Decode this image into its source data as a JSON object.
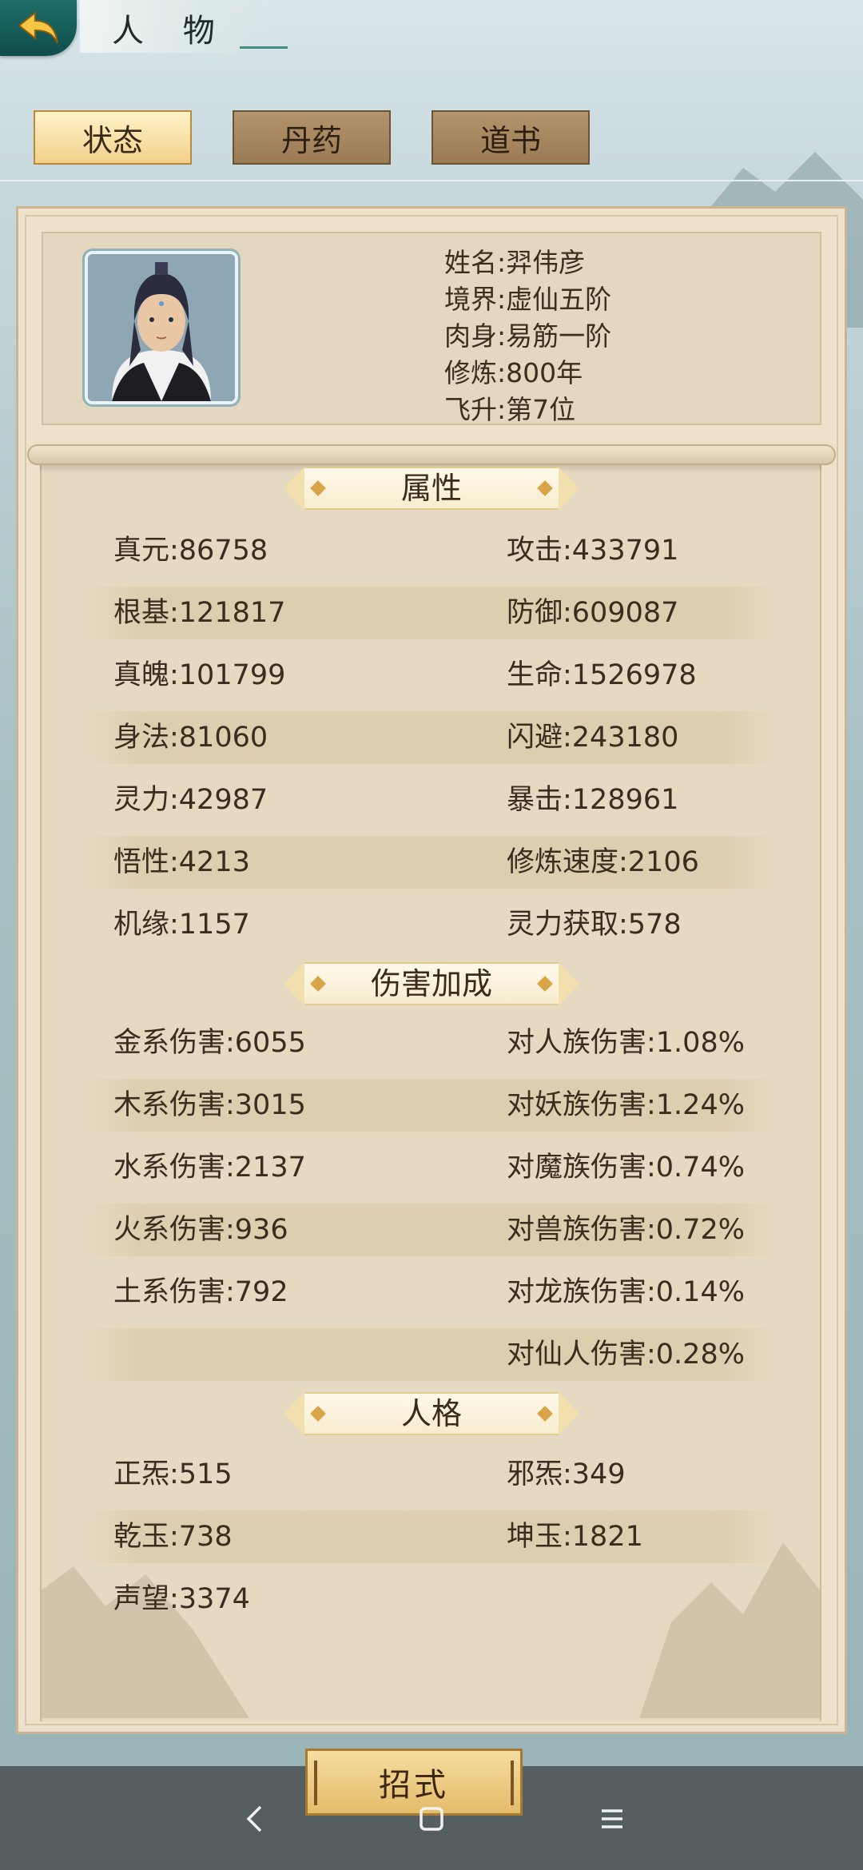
{
  "header": {
    "title": "人 物"
  },
  "tabs": [
    {
      "label": "状态",
      "active": true
    },
    {
      "label": "丹药",
      "active": false
    },
    {
      "label": "道书",
      "active": false
    }
  ],
  "profile": {
    "name": "姓名:羿伟彦",
    "realm": "境界:虚仙五阶",
    "body": "肉身:易筋一阶",
    "cultivation": "修炼:800年",
    "ascension": "飞升:第7位"
  },
  "sections": {
    "attributes": "属性",
    "damage": "伤害加成",
    "personality": "人格"
  },
  "attributes": [
    [
      "真元:86758",
      "攻击:433791"
    ],
    [
      "根基:121817",
      "防御:609087"
    ],
    [
      "真魄:101799",
      "生命:1526978"
    ],
    [
      "身法:81060",
      "闪避:243180"
    ],
    [
      "灵力:42987",
      "暴击:128961"
    ],
    [
      "悟性:4213",
      "修炼速度:2106"
    ],
    [
      "机缘:1157",
      "灵力获取:578"
    ]
  ],
  "damage": [
    [
      "金系伤害:6055",
      "对人族伤害:1.08%"
    ],
    [
      "木系伤害:3015",
      "对妖族伤害:1.24%"
    ],
    [
      "水系伤害:2137",
      "对魔族伤害:0.74%"
    ],
    [
      "火系伤害:936",
      "对兽族伤害:0.72%"
    ],
    [
      "土系伤害:792",
      "对龙族伤害:0.14%"
    ],
    [
      "",
      "对仙人伤害:0.28%"
    ]
  ],
  "personality": [
    [
      "正炁:515",
      "邪炁:349"
    ],
    [
      "乾玉:738",
      "坤玉:1821"
    ],
    [
      "声望:3374",
      ""
    ]
  ],
  "bottom": {
    "skill_button": "招式"
  },
  "colors": {
    "panel": "#ede1cc",
    "accent": "#1f6e6a",
    "text": "#3a2c1e"
  }
}
